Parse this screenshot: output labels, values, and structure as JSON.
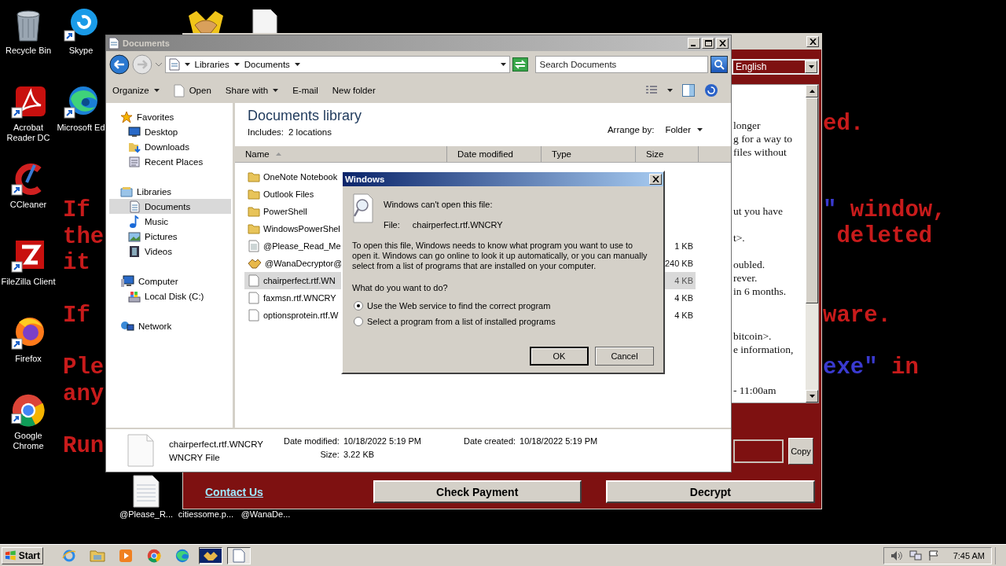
{
  "wallpaper": {
    "left": [
      [
        [
          {
            "text": "If",
            "color": "#c81b1b"
          }
        ],
        [
          {
            "text": "the",
            "color": "#c81b1b"
          }
        ],
        [
          {
            "text": "it",
            "color": "#c81b1b"
          }
        ]
      ],
      [
        [
          {
            "text": "If",
            "color": "#c81b1b"
          }
        ]
      ],
      [
        [
          {
            "text": "Ple",
            "color": "#c81b1b"
          }
        ],
        [
          {
            "text": "any",
            "color": "#c81b1b"
          }
        ]
      ],
      [
        [
          {
            "text": "Run",
            "color": "#c81b1b"
          }
        ]
      ]
    ],
    "right": [
      [
        [
          {
            "text": "ed.",
            "color": "#c81b1b"
          }
        ]
      ],
      [
        [
          {
            "text": "\"",
            "color": "#3a3ad0"
          },
          {
            "text": " window,",
            "color": "#c81b1b"
          }
        ],
        [
          {
            "text": " deleted",
            "color": "#c81b1b"
          }
        ]
      ],
      [
        [
          {
            "text": "ware.",
            "color": "#c81b1b"
          }
        ]
      ],
      [
        [
          {
            "text": "exe\"",
            "color": "#3a3ad0"
          },
          {
            "text": " in",
            "color": "#c81b1b"
          }
        ]
      ]
    ]
  },
  "desktop": {
    "columns": [
      [
        {
          "label": "Recycle Bin",
          "kind": "recycle"
        },
        {
          "label": "Acrobat Reader DC",
          "kind": "acrobat"
        },
        {
          "label": "CCleaner",
          "kind": "ccleaner"
        },
        {
          "label": "FileZilla Client",
          "kind": "filezilla"
        },
        {
          "label": "Firefox",
          "kind": "firefox"
        },
        {
          "label": "Google Chrome",
          "kind": "chrome"
        }
      ],
      [
        {
          "label": "Skype",
          "kind": "skype"
        },
        {
          "label": "Microsoft Ed",
          "kind": "edge"
        }
      ]
    ],
    "top_icons": [
      {
        "kind": "handshake"
      },
      {
        "kind": "document"
      }
    ],
    "bottom_icons": [
      {
        "label": "@Please_R...",
        "kind": "text"
      },
      {
        "label": "citiessome.p..."
      },
      {
        "label": "@WanaDe..."
      }
    ]
  },
  "decryptor": {
    "language": "English",
    "text_paragraphs": [
      [
        "longer",
        "g for a way to",
        "files without"
      ],
      [
        "ut you have"
      ],
      [
        "t>."
      ],
      [
        "oubled.",
        "rever.",
        "in 6 months."
      ],
      [
        "bitcoin>.",
        "e information,"
      ],
      [
        "- 11:00am"
      ]
    ],
    "copy_button": "Copy",
    "contact_link": "Contact Us",
    "buttons": [
      "Check Payment",
      "Decrypt"
    ]
  },
  "explorer": {
    "title": "Documents",
    "breadcrumb": [
      "Libraries",
      "Documents"
    ],
    "search": {
      "placeholder": "Search Documents"
    },
    "toolbar": [
      {
        "label": "Organize",
        "kind": "menu"
      },
      {
        "label": "Open",
        "kind": "open"
      },
      {
        "label": "Share with",
        "kind": "menu"
      },
      {
        "label": "E-mail",
        "kind": "plain"
      },
      {
        "label": "New folder",
        "kind": "plain"
      }
    ],
    "nav": [
      {
        "label": "Favorites",
        "kind": "star",
        "selected": false,
        "children": [
          {
            "label": "Desktop",
            "kind": "desktop",
            "selected": false
          },
          {
            "label": "Downloads",
            "kind": "downloads",
            "selected": false
          },
          {
            "label": "Recent Places",
            "kind": "recent",
            "selected": false
          }
        ]
      },
      {
        "label": "Libraries",
        "kind": "libraries",
        "selected": false,
        "children": [
          {
            "label": "Documents",
            "kind": "documents",
            "selected": true
          },
          {
            "label": "Music",
            "kind": "music",
            "selected": false
          },
          {
            "label": "Pictures",
            "kind": "pictures",
            "selected": false
          },
          {
            "label": "Videos",
            "kind": "videos",
            "selected": false
          }
        ]
      },
      {
        "label": "Computer",
        "kind": "computer",
        "selected": false,
        "children": [
          {
            "label": "Local Disk (C:)",
            "kind": "disk",
            "selected": false
          }
        ]
      },
      {
        "label": "Network",
        "kind": "network",
        "selected": false
      }
    ],
    "library": {
      "title": "Documents library",
      "includes_label": "Includes:",
      "includes_value": "2 locations",
      "arrange_label": "Arrange by:",
      "arrange_value": "Folder"
    },
    "columns": [
      {
        "label": "Name",
        "sorted": true
      },
      {
        "label": "Date modified",
        "sorted": false
      },
      {
        "label": "Type",
        "sorted": false
      },
      {
        "label": "Size",
        "sorted": false
      }
    ],
    "rows": [
      {
        "name": "OneNote Notebook",
        "kind": "folder",
        "selected": false
      },
      {
        "name": "Outlook Files",
        "kind": "folder",
        "selected": false
      },
      {
        "name": "PowerShell",
        "kind": "folder",
        "selected": false
      },
      {
        "name": "WindowsPowerShel",
        "kind": "folder",
        "selected": false
      },
      {
        "name": "@Please_Read_Me",
        "kind": "text",
        "size": "1 KB",
        "selected": false
      },
      {
        "name": "@WanaDecryptor@",
        "kind": "app",
        "size": "240 KB",
        "selected": false
      },
      {
        "name": "chairperfect.rtf.WN",
        "kind": "file",
        "size": "4 KB",
        "selected": true
      },
      {
        "name": "faxmsn.rtf.WNCRY",
        "kind": "file",
        "size": "4 KB",
        "selected": false
      },
      {
        "name": "optionsprotein.rtf.W",
        "kind": "file",
        "size": "4 KB",
        "selected": false
      }
    ],
    "details": {
      "name": "chairperfect.rtf.WNCRY",
      "type": "WNCRY File",
      "field_columns": [
        [
          {
            "label": "Date modified:",
            "value": "10/18/2022 5:19 PM"
          },
          {
            "label": "Size:",
            "value": "3.22 KB"
          }
        ],
        [
          {
            "label": "Date created:",
            "value": "10/18/2022 5:19 PM"
          }
        ]
      ]
    }
  },
  "dialog": {
    "title": "Windows",
    "heading": "Windows can't open this file:",
    "file_label": "File:",
    "file_name": "chairperfect.rtf.WNCRY",
    "message": "To open this file, Windows needs to know what program you want to use to open it. Windows can go online to look it up automatically, or you can manually select from a list of programs that are installed on your computer.",
    "question": "What do you want to do?",
    "options": [
      {
        "label": "Use the Web service to find the correct program",
        "selected": true
      },
      {
        "label": "Select a program from a list of installed programs",
        "selected": false
      }
    ],
    "buttons": [
      {
        "label": "OK",
        "default": true
      },
      {
        "label": "Cancel",
        "default": false
      }
    ]
  },
  "taskbar": {
    "start": "Start",
    "apps": [
      {
        "kind": "ie",
        "selected": false
      },
      {
        "kind": "explorer",
        "selected": false
      },
      {
        "kind": "media",
        "selected": false
      },
      {
        "kind": "chrome",
        "selected": false
      },
      {
        "kind": "edge",
        "selected": false
      },
      {
        "kind": "handshake",
        "selected": true
      },
      {
        "kind": "document",
        "selected": true
      }
    ],
    "clock": "7:45 AM"
  }
}
